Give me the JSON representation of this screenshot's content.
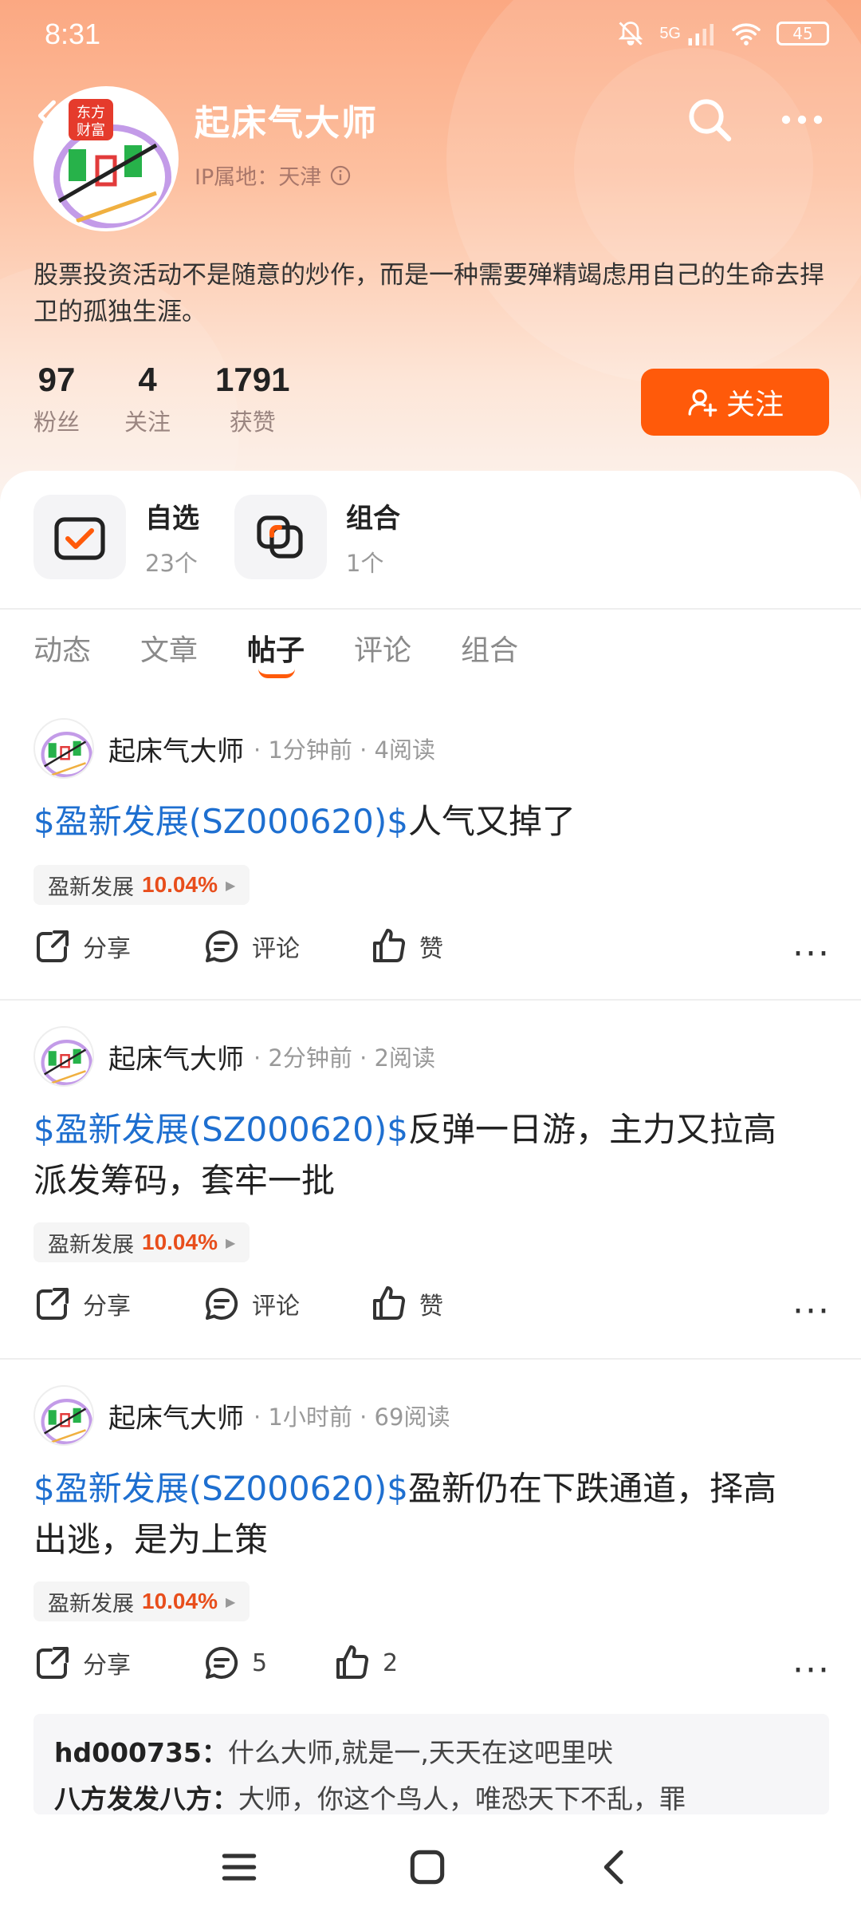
{
  "status": {
    "time": "8:31",
    "battery": "45",
    "network": "5G"
  },
  "profile": {
    "name": "起床气大师",
    "ip_label": "IP属地：天津",
    "avatar_badge": "东方财富",
    "bio": "股票投资活动不是随意的炒作，而是一种需要殚精竭虑用自己的生命去捍卫的孤独生涯。",
    "stats": [
      {
        "num": "97",
        "label": "粉丝"
      },
      {
        "num": "4",
        "label": "关注"
      },
      {
        "num": "1791",
        "label": "获赞"
      }
    ],
    "follow_label": "关注"
  },
  "quick": [
    {
      "title": "自选",
      "sub": "23个",
      "icon": "checklist-icon"
    },
    {
      "title": "组合",
      "sub": "1个",
      "icon": "portfolio-icon"
    }
  ],
  "tabs": [
    "动态",
    "文章",
    "帖子",
    "评论",
    "组合"
  ],
  "active_tab": "帖子",
  "posts": [
    {
      "author": "起床气大师",
      "meta": "· 1分钟前 · 4阅读",
      "stock_link": "$盈新发展(SZ000620)$",
      "text_line1": "人气又掉了",
      "text_line2": "",
      "tag_name": "盈新发展",
      "tag_pct": "10.04%",
      "share": "分享",
      "comment": "评论",
      "like": "赞"
    },
    {
      "author": "起床气大师",
      "meta": "· 2分钟前 · 2阅读",
      "stock_link": "$盈新发展(SZ000620)$",
      "text_line1": "反弹一日游，主力又拉高",
      "text_line2": "派发筹码，套牢一批",
      "tag_name": "盈新发展",
      "tag_pct": "10.04%",
      "share": "分享",
      "comment": "评论",
      "like": "赞"
    },
    {
      "author": "起床气大师",
      "meta": "· 1小时前 · 69阅读",
      "stock_link": "$盈新发展(SZ000620)$",
      "text_line1": "盈新仍在下跌通道，择高",
      "text_line2": "出逃，是为上策",
      "tag_name": "盈新发展",
      "tag_pct": "10.04%",
      "share": "分享",
      "comment": "5",
      "like": "2"
    }
  ],
  "comments": [
    {
      "user": "hd000735：",
      "text": "什么大师,就是一,天天在这吧里吠"
    },
    {
      "user": "八方发发八方：",
      "text": "大师，你这个鸟人，唯恐天下不乱，罪"
    }
  ],
  "colors": {
    "accent": "#ff5a0a",
    "link": "#1e6fd0",
    "up": "#e84e1c"
  }
}
